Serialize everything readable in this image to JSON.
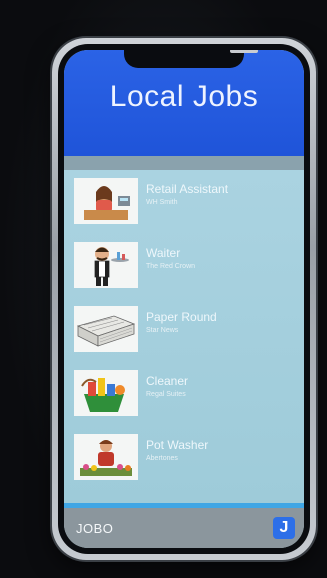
{
  "app": {
    "title": "Local Jobs",
    "footer_brand": "JOBO",
    "footer_icon_label": "J"
  },
  "jobs": [
    {
      "title": "Retail Assistant",
      "company": "WH Smith",
      "icon": "cashier-illustration"
    },
    {
      "title": "Waiter",
      "company": "The Red Crown",
      "icon": "waiter-illustration"
    },
    {
      "title": "Paper Round",
      "company": "Star News",
      "icon": "newspaper-stack-illustration"
    },
    {
      "title": "Cleaner",
      "company": "Regal Suites",
      "icon": "cleaning-supplies-illustration"
    },
    {
      "title": "Pot Washer",
      "company": "Abertones",
      "icon": "gardener-illustration"
    }
  ],
  "colors": {
    "header": "#2b63e6",
    "list_background": "#a9cfdc",
    "footer": "#8b969d",
    "accent": "#3fa6e5"
  }
}
